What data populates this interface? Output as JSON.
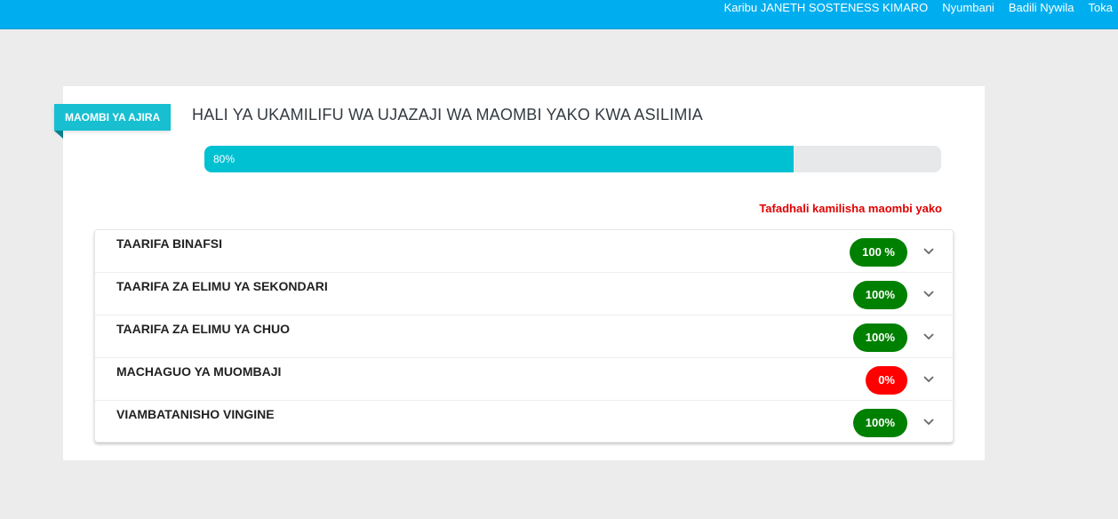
{
  "topbar": {
    "welcome": "Karibu JANETH SOSTENESS KIMARO",
    "links": [
      "Nyumbani",
      "Badili Nywila",
      "Toka"
    ]
  },
  "card": {
    "ribbon": "MAOMBI YA AJIRA",
    "title": "HALI YA UKAMILIFU WA UJAZAJI WA MAOMBI YAKO KWA ASILIMIA",
    "progress": {
      "value": 80,
      "label": "80%"
    },
    "notice": "Tafadhali kamilisha maombi yako"
  },
  "sections": [
    {
      "label": "TAARIFA BINAFSI",
      "badge": "100 %",
      "status": "complete"
    },
    {
      "label": "TAARIFA ZA ELIMU YA SEKONDARI",
      "badge": "100%",
      "status": "complete"
    },
    {
      "label": "TAARIFA ZA ELIMU YA CHUO",
      "badge": "100%",
      "status": "complete"
    },
    {
      "label": "MACHAGUO YA MUOMBAJI",
      "badge": "0%",
      "status": "incomplete"
    },
    {
      "label": "VIAMBATANISHO VINGINE",
      "badge": "100%",
      "status": "complete"
    }
  ],
  "colors": {
    "topbar": "#00aeef",
    "accent": "#17bfd1",
    "progress": "#00c1d2",
    "complete": "#008000",
    "incomplete": "#ff0000",
    "notice": "#e00000"
  },
  "icons": {
    "expand": "chevron-down-icon"
  }
}
